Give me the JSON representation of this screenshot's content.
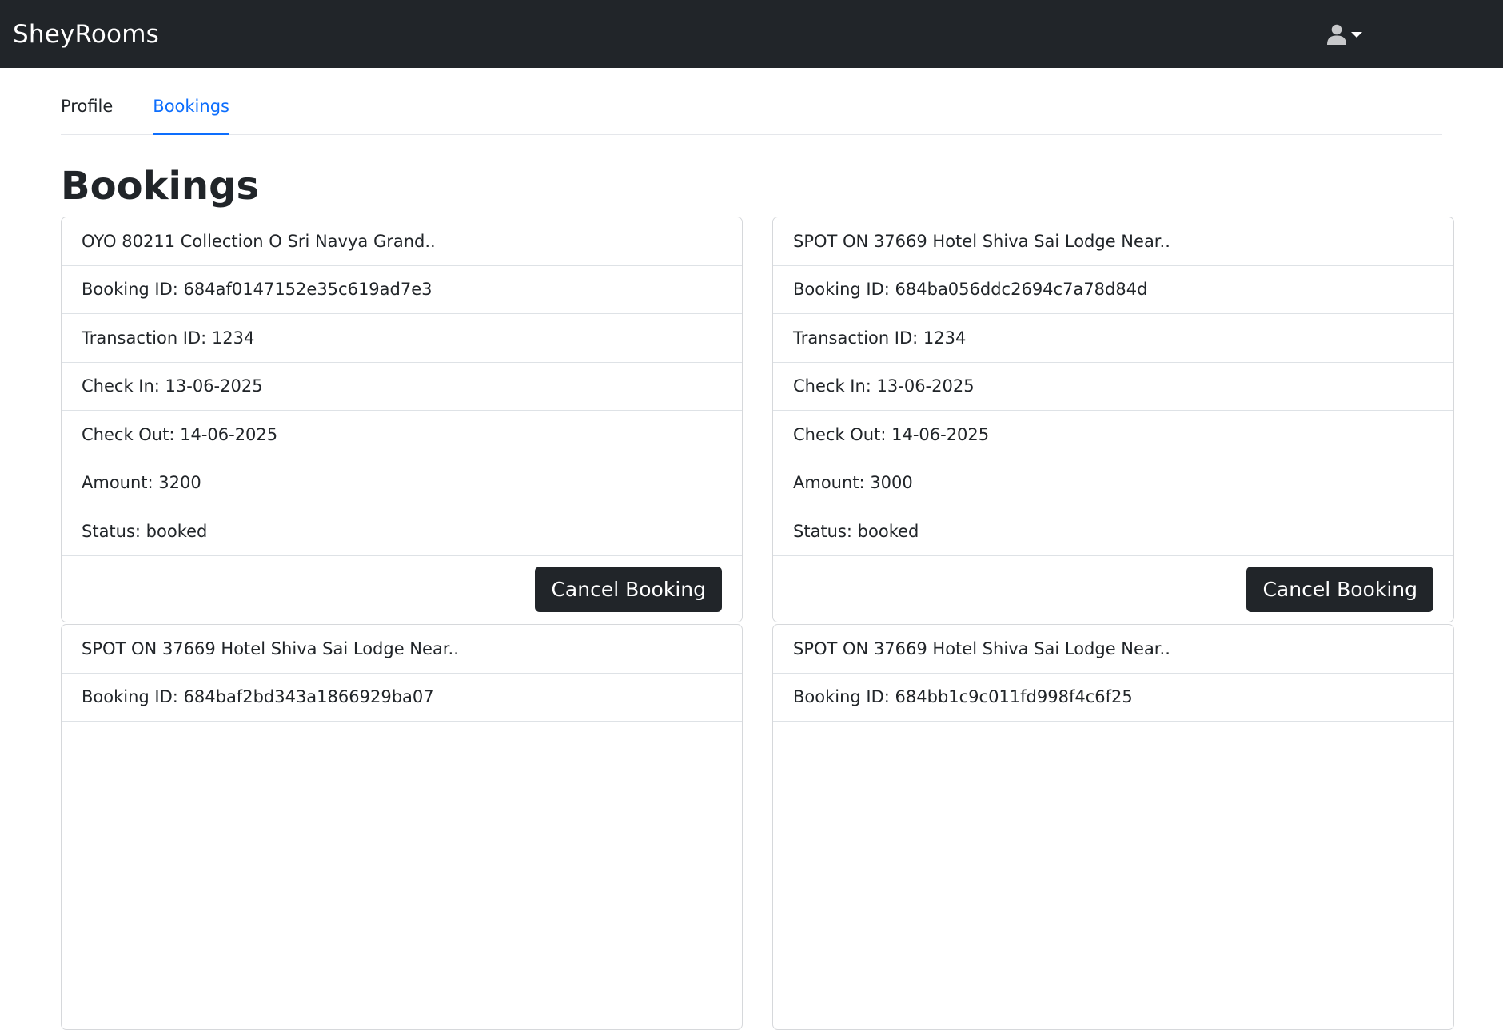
{
  "app": {
    "title": "SheyRooms"
  },
  "tabs": [
    {
      "label": "Profile"
    },
    {
      "label": "Bookings"
    }
  ],
  "page": {
    "heading": "Bookings"
  },
  "bookings": [
    {
      "name": "OYO 80211 Collection O Sri Navya Grand..",
      "booking_id": "Booking ID: 684af0147152e35c619ad7e3",
      "transaction_id": "Transaction ID: 1234",
      "check_in": "Check In: 13-06-2025",
      "check_out": "Check Out: 14-06-2025",
      "amount": "Amount: 3200",
      "status": "Status: booked",
      "button": "Cancel Booking"
    },
    {
      "name": "SPOT ON 37669 Hotel Shiva Sai Lodge Near..",
      "booking_id": "Booking ID: 684ba056ddc2694c7a78d84d",
      "transaction_id": "Transaction ID: 1234",
      "check_in": "Check In: 13-06-2025",
      "check_out": "Check Out: 14-06-2025",
      "amount": "Amount: 3000",
      "status": "Status: booked",
      "button": "Cancel Booking"
    },
    {
      "name": "SPOT ON 37669 Hotel Shiva Sai Lodge Near..",
      "booking_id": "Booking ID: 684baf2bd343a1866929ba07"
    },
    {
      "name": "SPOT ON 37669 Hotel Shiva Sai Lodge Near..",
      "booking_id": "Booking ID: 684bb1c9c011fd998f4c6f25"
    }
  ]
}
